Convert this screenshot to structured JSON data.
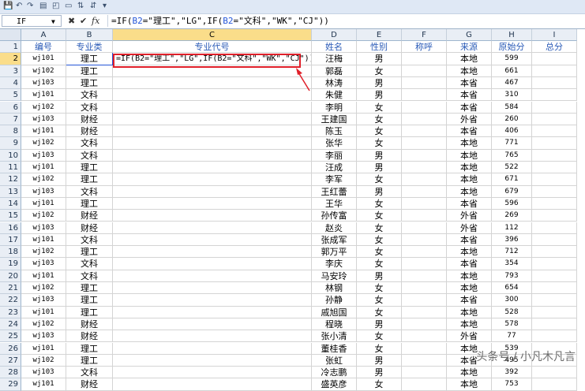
{
  "name_box": "IF",
  "formula": "=IF(B2=\"理工\",\"LG\",IF(B2=\"文科\",\"WK\",\"CJ\"))",
  "formula_parts": [
    "=IF(",
    "B2",
    "=\"理工\",\"LG\",IF(",
    "B2",
    "=\"文科\",\"WK\",\"CJ\"))"
  ],
  "columns": [
    "A",
    "B",
    "C",
    "D",
    "E",
    "F",
    "G",
    "H",
    "I"
  ],
  "headers": [
    "编号",
    "专业类",
    "专业代号",
    "姓名",
    "性别",
    "称呼",
    "来源",
    "原始分",
    "总分"
  ],
  "rows": [
    [
      "wj101",
      "理工",
      "",
      "汪梅",
      "男",
      "",
      "本地",
      "599",
      ""
    ],
    [
      "wj102",
      "理工",
      "",
      "郭磊",
      "女",
      "",
      "本地",
      "661",
      ""
    ],
    [
      "wj103",
      "理工",
      "",
      "林涛",
      "男",
      "",
      "本省",
      "467",
      ""
    ],
    [
      "wj101",
      "文科",
      "",
      "朱健",
      "男",
      "",
      "本省",
      "310",
      ""
    ],
    [
      "wj102",
      "文科",
      "",
      "李明",
      "女",
      "",
      "本省",
      "584",
      ""
    ],
    [
      "wj103",
      "财经",
      "",
      "王建国",
      "女",
      "",
      "外省",
      "260",
      ""
    ],
    [
      "wj101",
      "财经",
      "",
      "陈玉",
      "女",
      "",
      "本省",
      "406",
      ""
    ],
    [
      "wj102",
      "文科",
      "",
      "张华",
      "女",
      "",
      "本地",
      "771",
      ""
    ],
    [
      "wj103",
      "文科",
      "",
      "李丽",
      "男",
      "",
      "本地",
      "765",
      ""
    ],
    [
      "wj101",
      "理工",
      "",
      "汪成",
      "男",
      "",
      "本地",
      "522",
      ""
    ],
    [
      "wj102",
      "理工",
      "",
      "李军",
      "女",
      "",
      "本地",
      "671",
      ""
    ],
    [
      "wj103",
      "文科",
      "",
      "王红蕾",
      "男",
      "",
      "本地",
      "679",
      ""
    ],
    [
      "wj101",
      "理工",
      "",
      "王华",
      "女",
      "",
      "本省",
      "596",
      ""
    ],
    [
      "wj102",
      "财经",
      "",
      "孙传富",
      "女",
      "",
      "外省",
      "269",
      ""
    ],
    [
      "wj103",
      "财经",
      "",
      "赵炎",
      "女",
      "",
      "外省",
      "112",
      ""
    ],
    [
      "wj101",
      "文科",
      "",
      "张成军",
      "女",
      "",
      "本省",
      "396",
      ""
    ],
    [
      "wj102",
      "理工",
      "",
      "郭万平",
      "女",
      "",
      "本地",
      "712",
      ""
    ],
    [
      "wj103",
      "文科",
      "",
      "李庆",
      "女",
      "",
      "本省",
      "354",
      ""
    ],
    [
      "wj101",
      "文科",
      "",
      "马安玲",
      "男",
      "",
      "本地",
      "793",
      ""
    ],
    [
      "wj102",
      "理工",
      "",
      "林钢",
      "女",
      "",
      "本地",
      "654",
      ""
    ],
    [
      "wj103",
      "理工",
      "",
      "孙静",
      "女",
      "",
      "本省",
      "300",
      ""
    ],
    [
      "wj101",
      "理工",
      "",
      "戚旭国",
      "女",
      "",
      "本地",
      "528",
      ""
    ],
    [
      "wj102",
      "财经",
      "",
      "程晓",
      "男",
      "",
      "本地",
      "578",
      ""
    ],
    [
      "wj103",
      "财经",
      "",
      "张小清",
      "女",
      "",
      "外省",
      "77",
      ""
    ],
    [
      "wj101",
      "理工",
      "",
      "董桂香",
      "女",
      "",
      "本地",
      "539",
      ""
    ],
    [
      "wj102",
      "理工",
      "",
      "张虹",
      "男",
      "",
      "本省",
      "495",
      ""
    ],
    [
      "wj103",
      "文科",
      "",
      "冷志鹏",
      "男",
      "",
      "本地",
      "392",
      ""
    ],
    [
      "wj101",
      "财经",
      "",
      "盛英彦",
      "女",
      "",
      "本地",
      "753",
      ""
    ]
  ],
  "watermark": "头条号 / 小凡木凡言",
  "colors": {
    "accent_red": "#e0202a",
    "header_blue": "#2a5bb7",
    "selected_header": "#fadd8a"
  },
  "icons": [
    "save-icon",
    "undo-icon",
    "redo-icon",
    "cancel-icon",
    "confirm-icon",
    "function-icon"
  ]
}
